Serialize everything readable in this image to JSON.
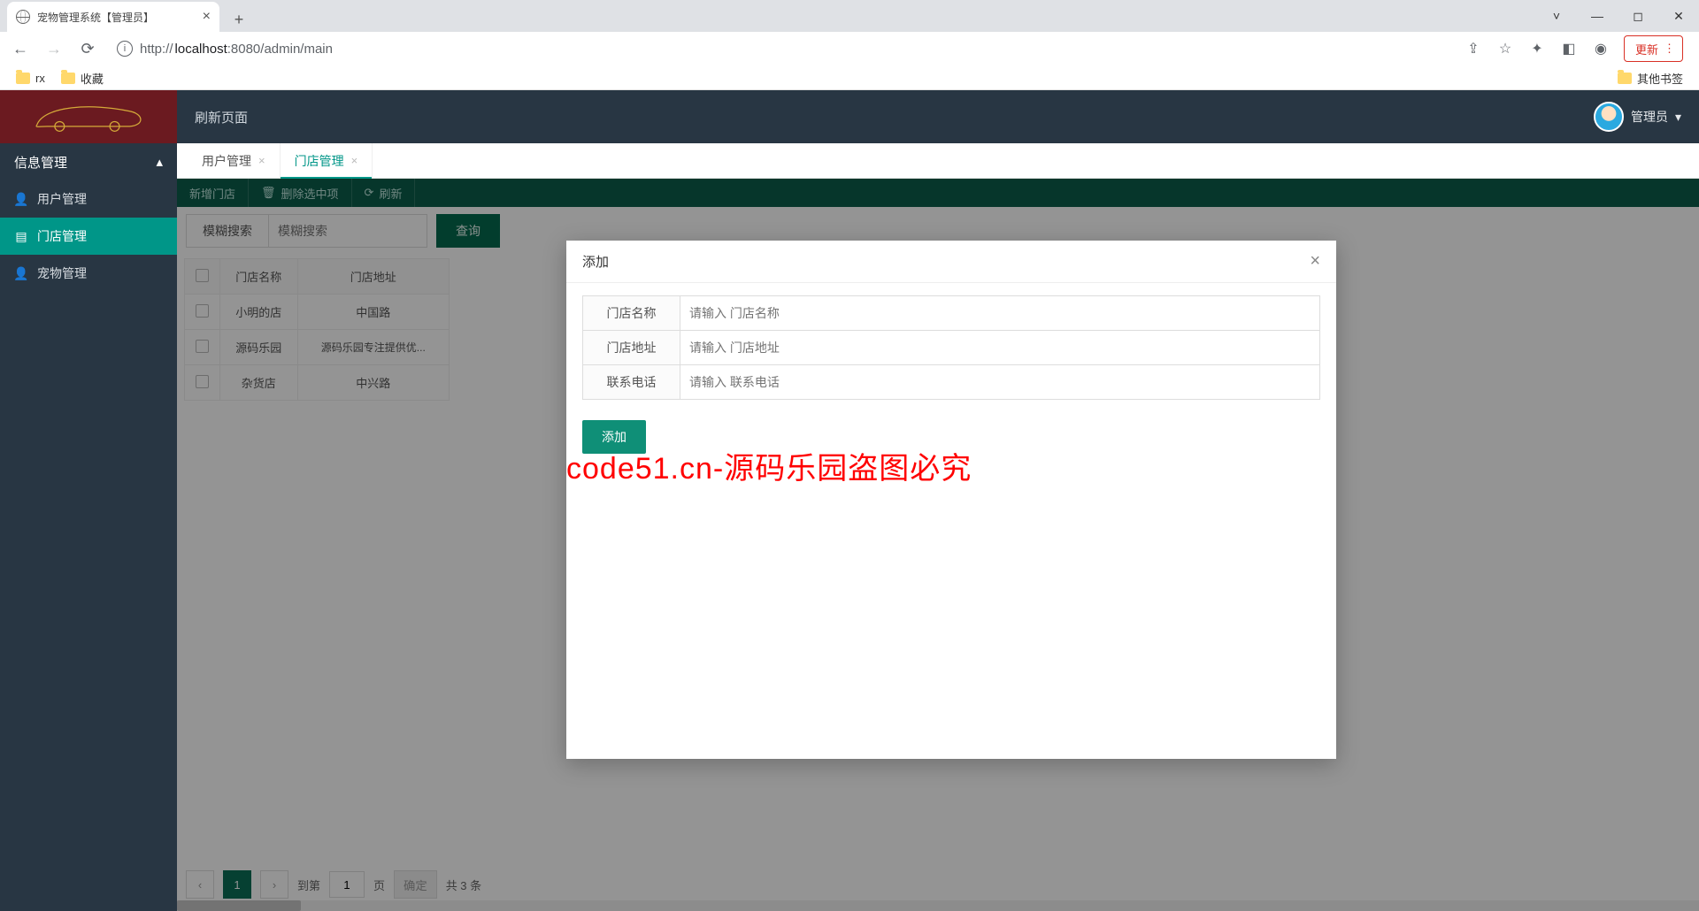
{
  "browser": {
    "tab_title": "宠物管理系统【管理员】",
    "url_host": "localhost",
    "url_port": ":8080",
    "url_path": "/admin/main",
    "url_proto": "http://",
    "update_btn": "更新",
    "bookmarks": [
      "rx",
      "收藏"
    ],
    "other_bookmarks": "其他书签"
  },
  "app": {
    "topbar_refresh": "刷新页面",
    "user_label": "管理员",
    "sidebar": {
      "category": "信息管理",
      "items": [
        {
          "label": "用户管理"
        },
        {
          "label": "门店管理"
        },
        {
          "label": "宠物管理"
        }
      ]
    },
    "tabs": [
      {
        "label": "用户管理"
      },
      {
        "label": "门店管理"
      }
    ],
    "toolbar": {
      "add": "新增门店",
      "del": "删除选中项",
      "refresh": "刷新"
    },
    "search": {
      "label": "模糊搜索",
      "placeholder": "模糊搜索",
      "query_btn": "查询"
    },
    "table": {
      "columns": [
        "",
        "门店名称",
        "门店地址"
      ],
      "rows": [
        [
          "小明的店",
          "中国路"
        ],
        [
          "源码乐园",
          "源码乐园专注提供优..."
        ],
        [
          "杂货店",
          "中兴路"
        ]
      ]
    },
    "pager": {
      "current": "1",
      "goto_label": "到第",
      "page_suffix": "页",
      "confirm": "确定",
      "total": "共 3 条",
      "goto_value": "1"
    }
  },
  "modal": {
    "title": "添加",
    "fields": [
      {
        "label": "门店名称",
        "placeholder": "请输入 门店名称"
      },
      {
        "label": "门店地址",
        "placeholder": "请输入 门店地址"
      },
      {
        "label": "联系电话",
        "placeholder": "请输入 联系电话"
      }
    ],
    "submit": "添加"
  },
  "watermark": "code51.cn-源码乐园盗图必究"
}
